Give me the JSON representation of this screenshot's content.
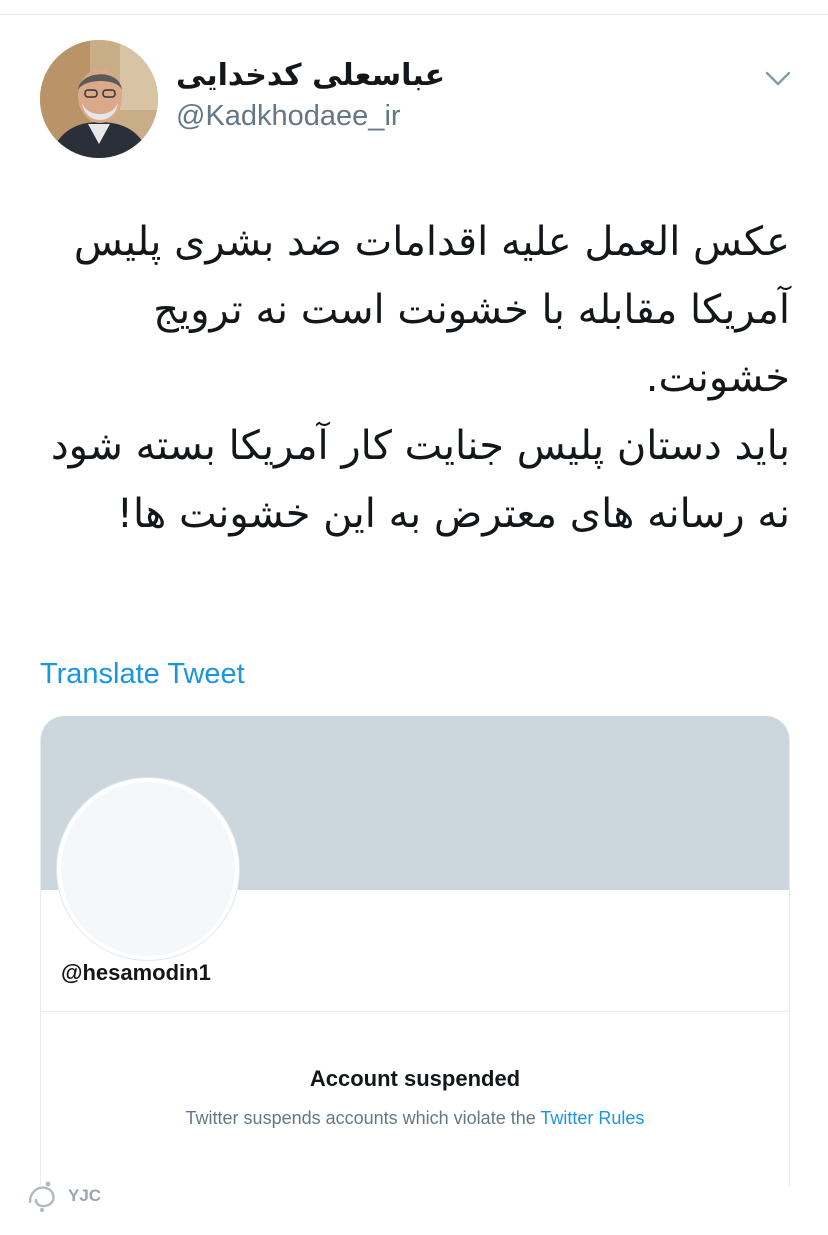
{
  "tweet": {
    "author": {
      "display_name": "عباسعلی کدخدایی",
      "handle": "@Kadkhodaee_ir"
    },
    "paragraphs": [
      "عکس العمل علیه اقدامات ضد بشری پلیس آمریکا مقابله با خشونت است نه ترویج خشونت.",
      "باید دستان پلیس جنایت کار آمریکا بسته شود نه رسانه های معترض به این خشونت ها!"
    ],
    "translate_label": "Translate Tweet"
  },
  "embedded_card": {
    "handle": "@hesamodin1",
    "status_title": "Account suspended",
    "status_text": "Twitter suspends accounts which violate the ",
    "rules_link": "Twitter Rules"
  },
  "watermark": {
    "text": "YJC"
  },
  "colors": {
    "link": "#1b95e0",
    "secondary_text": "#657786",
    "banner": "#ccd6dd"
  },
  "icons": [
    "chevron-down-icon",
    "profile-avatar",
    "watermark-logo-icon"
  ]
}
